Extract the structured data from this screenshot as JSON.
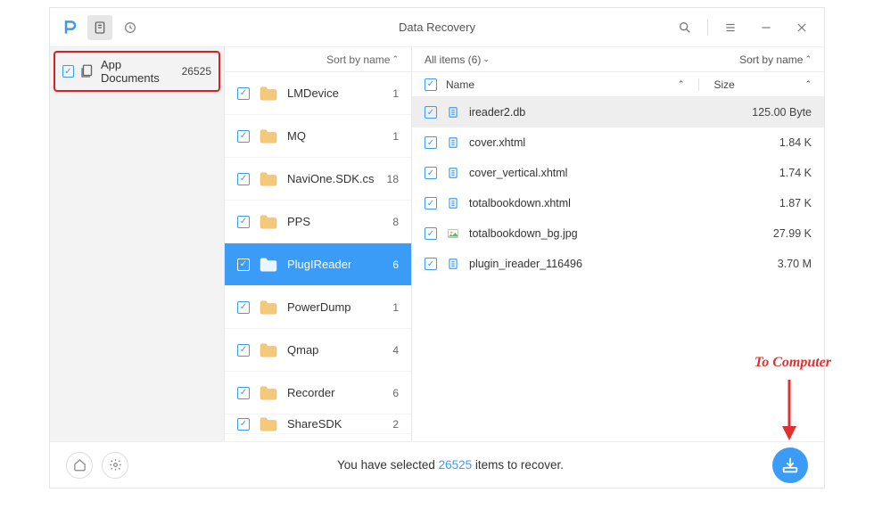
{
  "window": {
    "title": "Data Recovery"
  },
  "sidebar": {
    "items": [
      {
        "label": "App Documents",
        "count": "26525"
      }
    ]
  },
  "folders": {
    "sort_label": "Sort by name",
    "list": [
      {
        "name": "LMDevice",
        "count": "1",
        "selected": false
      },
      {
        "name": "MQ",
        "count": "1",
        "selected": false
      },
      {
        "name": "NaviOne.SDK.cs",
        "count": "18",
        "selected": false
      },
      {
        "name": "PPS",
        "count": "8",
        "selected": false
      },
      {
        "name": "PlugIReader",
        "count": "6",
        "selected": true
      },
      {
        "name": "PowerDump",
        "count": "1",
        "selected": false
      },
      {
        "name": "Qmap",
        "count": "4",
        "selected": false
      },
      {
        "name": "Recorder",
        "count": "6",
        "selected": false
      },
      {
        "name": "ShareSDK",
        "count": "2",
        "selected": false
      }
    ]
  },
  "files": {
    "header_left": "All items (6)",
    "sort_label": "Sort by name",
    "col_name": "Name",
    "col_size": "Size",
    "list": [
      {
        "name": "ireader2.db",
        "size": "125.00 Byte",
        "icon": "doc",
        "selected": true
      },
      {
        "name": "cover.xhtml",
        "size": "1.84 K",
        "icon": "doc",
        "selected": false
      },
      {
        "name": "cover_vertical.xhtml",
        "size": "1.74 K",
        "icon": "doc",
        "selected": false
      },
      {
        "name": "totalbookdown.xhtml",
        "size": "1.87 K",
        "icon": "doc",
        "selected": false
      },
      {
        "name": "totalbookdown_bg.jpg",
        "size": "27.99 K",
        "icon": "img",
        "selected": false
      },
      {
        "name": "plugin_ireader_116496",
        "size": "3.70 M",
        "icon": "doc",
        "selected": false
      }
    ]
  },
  "footer": {
    "msg_prefix": "You have selected ",
    "msg_count": "26525",
    "msg_suffix": " items to recover."
  },
  "annotation": {
    "label": "To Computer"
  }
}
